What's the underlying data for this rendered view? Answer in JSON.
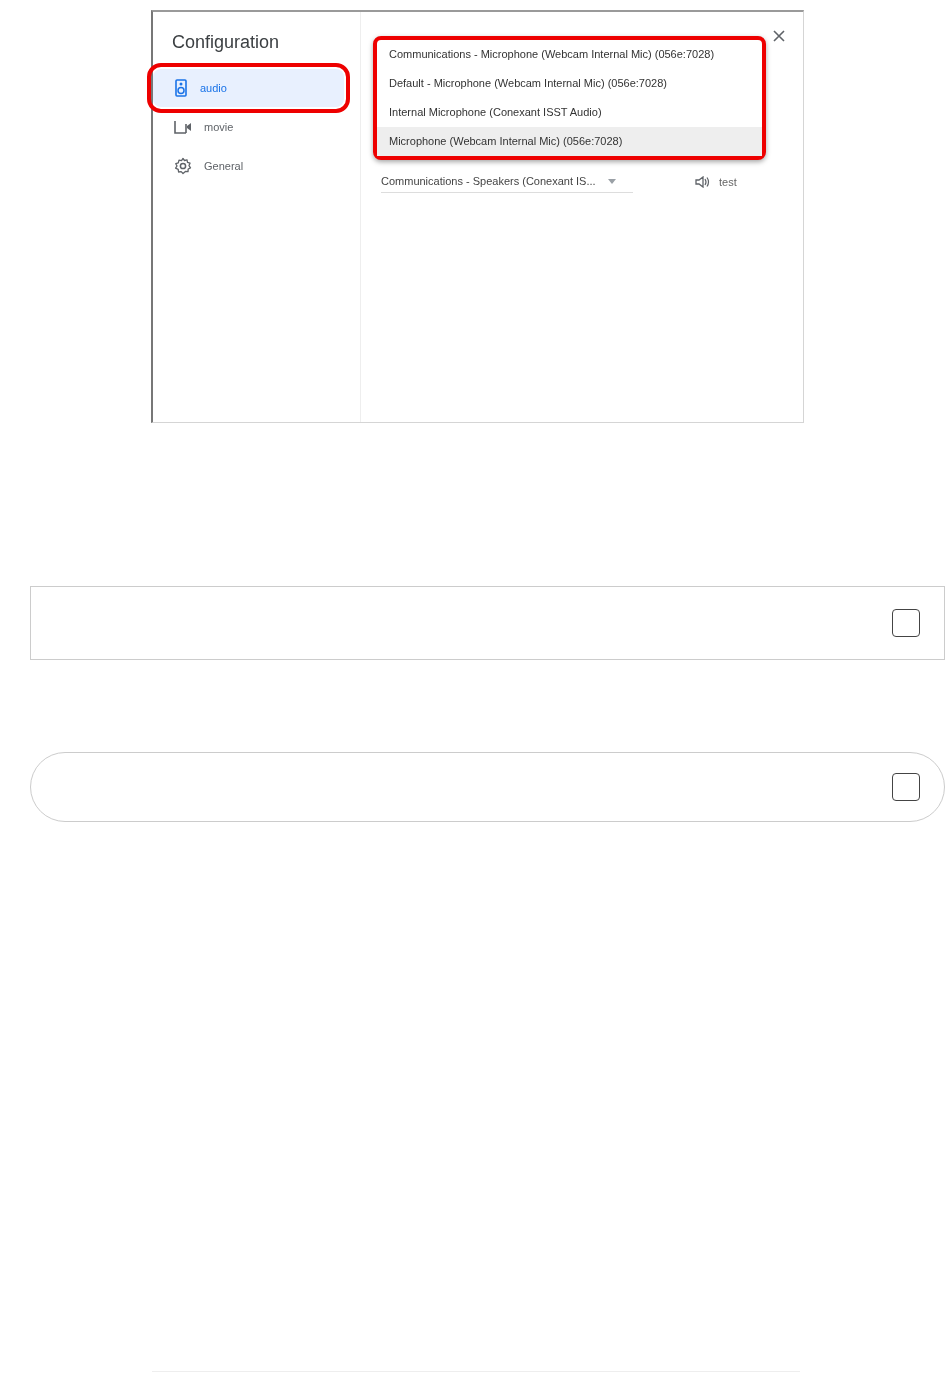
{
  "dialog": {
    "title": "Configuration",
    "nav": [
      {
        "label": "audio",
        "kind": "speaker",
        "selected": true,
        "highlighted": true
      },
      {
        "label": "movie",
        "kind": "camera",
        "selected": false,
        "highlighted": false
      },
      {
        "label": "General",
        "kind": "gear",
        "selected": false,
        "highlighted": false
      }
    ],
    "menu": {
      "highlighted": true,
      "items": [
        {
          "label": "Communications - Microphone (Webcam Internal Mic) (056e:7028)",
          "selected": false
        },
        {
          "label": "Default - Microphone (Webcam Internal Mic) (056e:7028)",
          "selected": false
        },
        {
          "label": "Internal Microphone (Conexant ISST Audio)",
          "selected": false
        },
        {
          "label": "Microphone (Webcam Internal Mic) (056e:7028)",
          "selected": true
        }
      ]
    },
    "speaker_select": {
      "value": "Communications - Speakers (Conexant IS..."
    },
    "test_button": {
      "label": "test"
    }
  },
  "boxes": [
    {
      "kind": "square",
      "checked": false
    },
    {
      "kind": "pill",
      "checked": false
    }
  ]
}
